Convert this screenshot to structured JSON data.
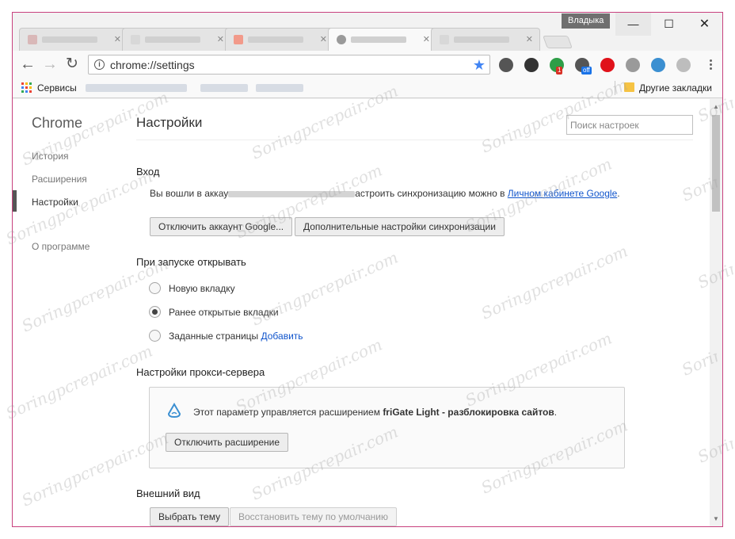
{
  "window": {
    "profile_name": "Владыка",
    "controls": {
      "minimize": "—",
      "maximize": "☐",
      "close": "✕"
    }
  },
  "toolbar": {
    "url": "chrome://settings",
    "info_glyph": "i",
    "back_glyph": "←",
    "forward_glyph": "→",
    "reload_glyph": "↻",
    "star_glyph": "★",
    "extensions": [
      {
        "icon": "pocket-icon",
        "color": "#555555"
      },
      {
        "icon": "evernote-icon",
        "color": "#333333"
      },
      {
        "icon": "onetab-icon",
        "color": "#2e9e47",
        "badge": "1",
        "badge_color": "#d93025"
      },
      {
        "icon": "adblock-off-icon",
        "color": "#555555",
        "badge": "off",
        "badge_color": "#1a73e8"
      },
      {
        "icon": "opera-icon",
        "color": "#e0121a"
      },
      {
        "icon": "gear-ext-icon",
        "color": "#9a9a9a"
      },
      {
        "icon": "frigate-icon",
        "color": "#3b8fd1"
      },
      {
        "icon": "shield-ext-icon",
        "color": "#bdbdbd"
      }
    ]
  },
  "bookmarks": {
    "apps_label": "Сервисы",
    "other_label": "Другие закладки"
  },
  "sidebar": {
    "title": "Chrome",
    "items": [
      {
        "label": "История"
      },
      {
        "label": "Расширения"
      },
      {
        "label": "Настройки"
      },
      {
        "label": "О программе"
      }
    ]
  },
  "main": {
    "title": "Настройки",
    "search_placeholder": "Поиск настроек",
    "signin": {
      "heading": "Вход",
      "text_prefix": "Вы вошли в аккау",
      "text_mid": "астроить синхронизацию можно в ",
      "link": "Личном кабинете Google",
      "text_end": ".",
      "buttons": [
        "Отключить аккаунт Google...",
        "Дополнительные настройки синхронизации"
      ]
    },
    "startup": {
      "heading": "При запуске открывать",
      "options": [
        {
          "label": "Новую вкладку",
          "checked": false
        },
        {
          "label": "Ранее открытые вкладки",
          "checked": true
        },
        {
          "label": "Заданные страницы",
          "checked": false
        }
      ],
      "add_link": "Добавить"
    },
    "proxy": {
      "heading": "Настройки прокси-сервера",
      "text_prefix": "Этот параметр управляется расширением ",
      "ext_name": "friGate Light - разблокировка сайтов",
      "text_end": ".",
      "button": "Отключить расширение"
    },
    "appearance": {
      "heading": "Внешний вид",
      "buttons": [
        "Выбрать тему",
        "Восстановить тему по умолчанию"
      ]
    }
  },
  "watermark": "Soringpcrepair.com"
}
